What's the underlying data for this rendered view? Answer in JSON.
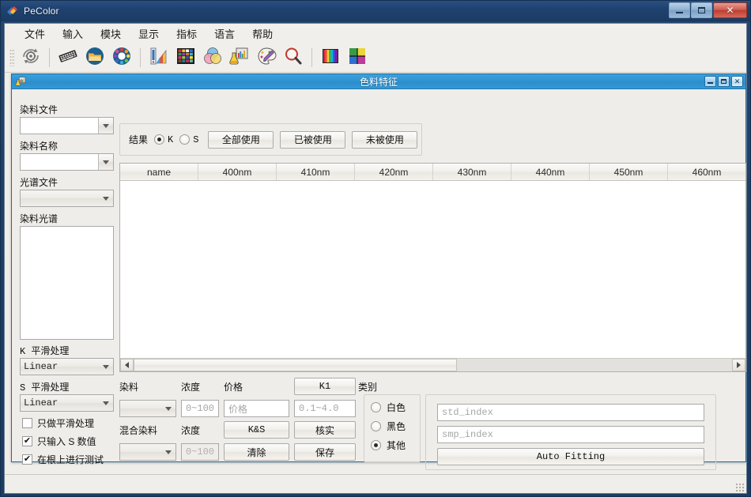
{
  "window": {
    "title": "PeColor",
    "app_icon": "pecolor-logo-icon",
    "minimize_label": "",
    "maximize_label": "",
    "close_label": "✕"
  },
  "menubar": {
    "items": [
      {
        "label": "文件",
        "name": "menu-file"
      },
      {
        "label": "输入",
        "name": "menu-input"
      },
      {
        "label": "模块",
        "name": "menu-module"
      },
      {
        "label": "显示",
        "name": "menu-display"
      },
      {
        "label": "指标",
        "name": "menu-metrics"
      },
      {
        "label": "语言",
        "name": "menu-language"
      },
      {
        "label": "帮助",
        "name": "menu-help"
      }
    ]
  },
  "toolbar": {
    "buttons": [
      {
        "icon": "gear-refresh-icon"
      },
      {
        "icon": "keyboard-icon"
      },
      {
        "icon": "open-folder-icon"
      },
      {
        "icon": "color-wheel-icon"
      },
      {
        "icon": "color-fan-deck-icon"
      },
      {
        "icon": "color-swatch-grid-icon"
      },
      {
        "icon": "venn-color-circles-icon"
      },
      {
        "icon": "lab-flask-icon"
      },
      {
        "icon": "artist-palette-icon"
      },
      {
        "icon": "magnifier-icon"
      },
      {
        "icon": "spectrum-bars-icon"
      },
      {
        "icon": "color-picker-grid-icon"
      }
    ]
  },
  "child_window": {
    "title": "色料特征",
    "icon": "lab-flask-icon",
    "minimize_label": "",
    "maximize_label": "",
    "close_label": "✕"
  },
  "left_panel": {
    "dye_file_label": "染料文件",
    "dye_file_value": "",
    "dye_name_label": "染料名称",
    "dye_name_value": "",
    "spectrum_file_label": "光谱文件",
    "spectrum_file_value": "",
    "dye_spectrum_label": "染料光谱",
    "dye_spectrum_value": "",
    "k_smooth_label": "K 平滑处理",
    "k_smooth_value": "Linear",
    "s_smooth_label": "S 平滑处理",
    "s_smooth_value": "Linear",
    "checkboxes": [
      {
        "label": "只做平滑处理",
        "checked": false,
        "name": "checkbox-smooth-only"
      },
      {
        "label": "只输入 S 数值",
        "checked": true,
        "name": "checkbox-input-s-only"
      },
      {
        "label": "在根上进行测试",
        "checked": true,
        "name": "checkbox-test-on-root"
      }
    ]
  },
  "result_bar": {
    "result_label": "结果",
    "radio_k": "K",
    "radio_s": "S",
    "radio_selected": "K",
    "buttons": [
      {
        "label": "全部使用",
        "name": "button-use-all"
      },
      {
        "label": "已被使用",
        "name": "button-used"
      },
      {
        "label": "未被使用",
        "name": "button-unused"
      }
    ]
  },
  "table": {
    "columns": [
      "name",
      "400nm",
      "410nm",
      "420nm",
      "430nm",
      "440nm",
      "450nm",
      "460nm"
    ],
    "rows": []
  },
  "bottom_form": {
    "dye_label": "染料",
    "concentration_label": "浓度",
    "price_label": "价格",
    "mixed_dye_label": "混合染料",
    "concentration2_label": "浓度",
    "dye_value": "",
    "concentration_placeholder": "0~100",
    "price_placeholder": "价格",
    "k1_range_placeholder": "0.1~4.0",
    "mixed_dye_value": "",
    "concentration2_placeholder": "0~100",
    "buttons": {
      "k1": "K1",
      "ks": "K&S",
      "verify": "核实",
      "clear": "清除",
      "save": "保存"
    }
  },
  "category": {
    "title": "类别",
    "options": [
      {
        "label": "白色",
        "selected": false,
        "name": "radio-white"
      },
      {
        "label": "黑色",
        "selected": false,
        "name": "radio-black"
      },
      {
        "label": "其他",
        "selected": true,
        "name": "radio-other"
      }
    ]
  },
  "fitting_panel": {
    "std_index_placeholder": "std_index",
    "std_index_value": "",
    "smp_index_placeholder": "smp_index",
    "smp_index_value": "",
    "auto_fitting_label": "Auto Fitting"
  },
  "colors": {
    "outer_titlebar": "#1d3f66",
    "child_titlebar": "#2f93d1",
    "client_bg": "#f0eeea",
    "accent": "#2f93d1"
  }
}
